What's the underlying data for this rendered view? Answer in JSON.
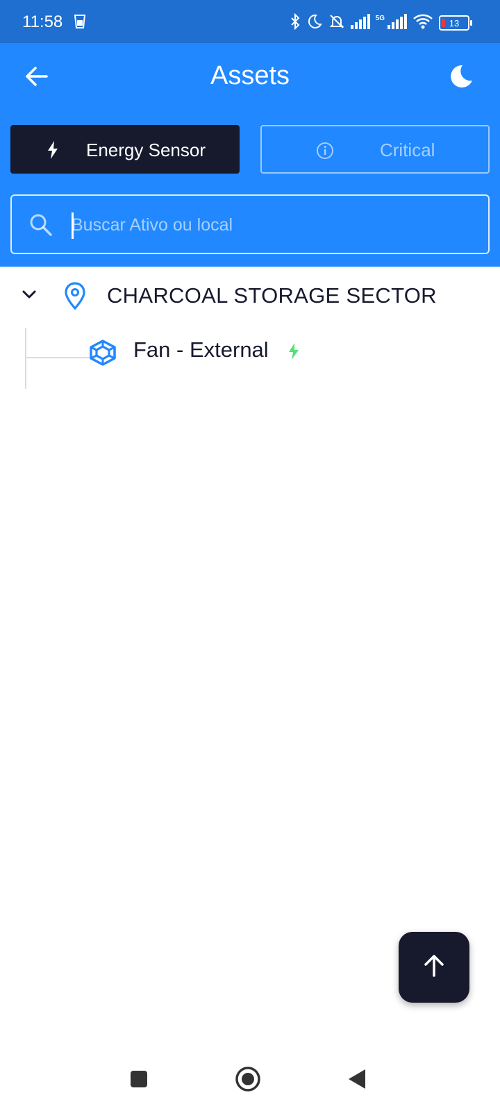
{
  "status_bar": {
    "time": "11:58",
    "network_label": "5G",
    "battery_level": "13",
    "icons": [
      "trash-icon",
      "bluetooth-icon",
      "moon-icon",
      "bell-off-icon",
      "signal-icon",
      "signal-5g-icon",
      "wifi-icon",
      "battery-icon"
    ]
  },
  "header": {
    "title": "Assets",
    "back_icon": "arrow-left-icon",
    "theme_icon": "moon-icon",
    "background": "#2188ff"
  },
  "filters": {
    "energy": {
      "label": "Energy Sensor",
      "icon": "bolt-icon",
      "active": true
    },
    "critical": {
      "label": "Critical",
      "icon": "info-circle-icon",
      "active": false
    }
  },
  "search": {
    "placeholder": "Buscar Ativo ou local",
    "value": ""
  },
  "tree": {
    "location": {
      "label": "CHARCOAL STORAGE SECTOR",
      "icon": "location-pin-icon",
      "expanded": true
    },
    "children": [
      {
        "label": "Fan - External",
        "icon": "component-icon",
        "sensor": "energy",
        "sensor_color": "#52e27a"
      }
    ]
  },
  "fab": {
    "icon": "arrow-up-icon"
  },
  "colors": {
    "primary": "#2188ff",
    "status_bar": "#1e6fcf",
    "dark": "#17192d",
    "sensor_green": "#52e27a"
  }
}
